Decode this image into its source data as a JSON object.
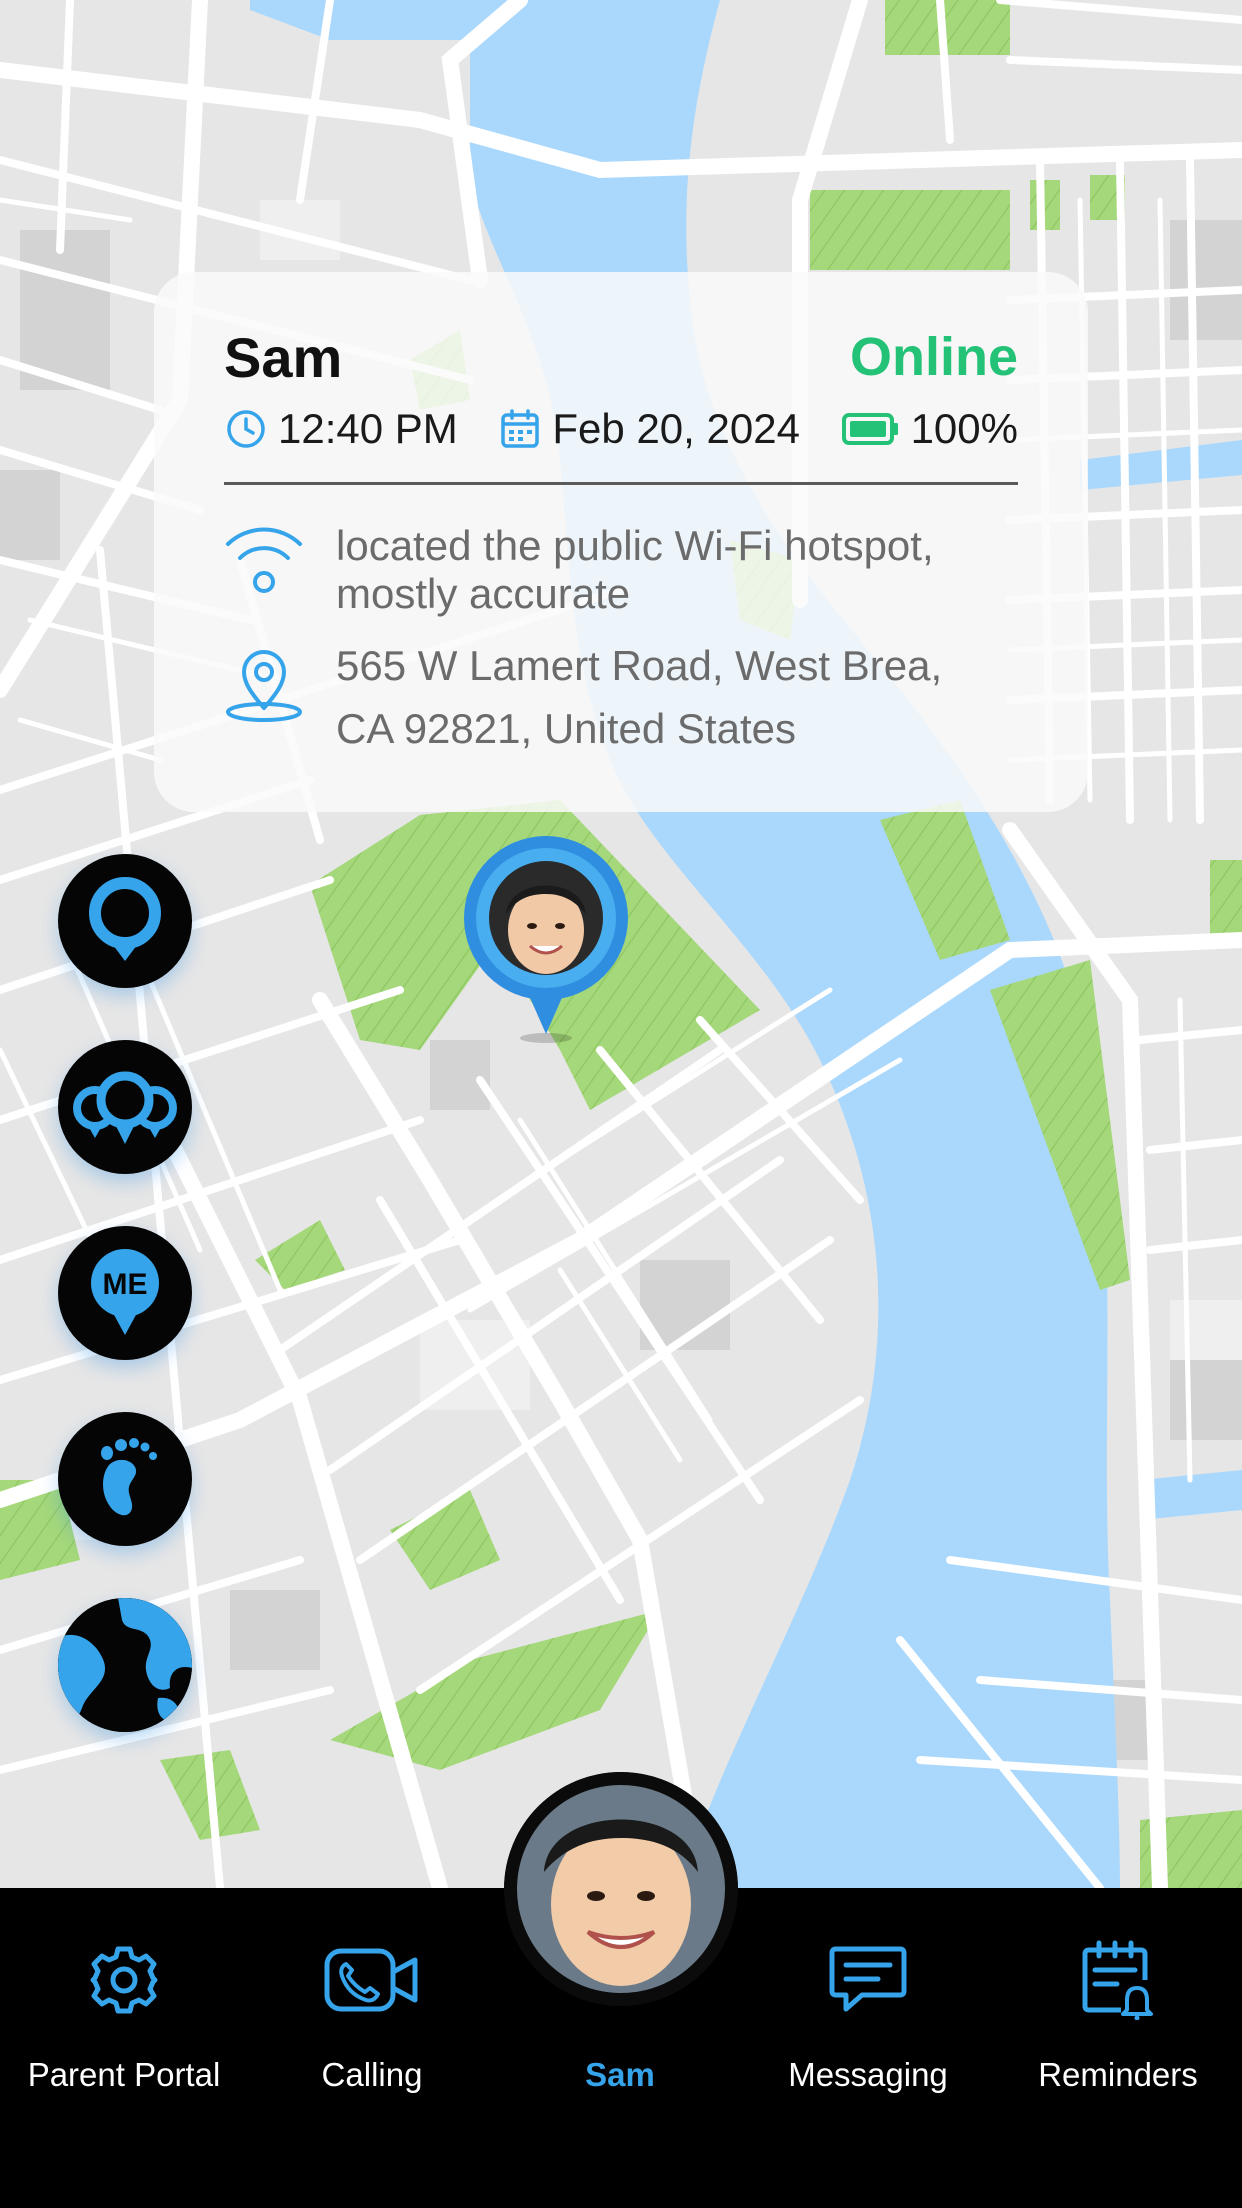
{
  "colors": {
    "accent_blue": "#35a4ea",
    "online_green": "#23c277",
    "water": "#aad8fd",
    "park": "#a5d87a",
    "land": "#e6e6e6",
    "road": "#ffffff"
  },
  "card": {
    "name": "Sam",
    "status": "Online",
    "time": "12:40 PM",
    "date": "Feb 20, 2024",
    "battery": "100%",
    "battery_level": 1.0,
    "wifi_text": "located the public Wi-Fi hotspot, mostly accurate",
    "address_line1": "565 W Lamert Road, West Brea,",
    "address_line2": "CA 92821, United States"
  },
  "side_buttons": [
    {
      "name": "location-pin-button",
      "icon": "single-pin-icon"
    },
    {
      "name": "group-location-button",
      "icon": "multi-pin-icon"
    },
    {
      "name": "me-location-button",
      "icon": "me-pin-icon"
    },
    {
      "name": "footprint-button",
      "icon": "footprints-icon"
    },
    {
      "name": "globe-button",
      "icon": "globe-icon"
    }
  ],
  "nav": {
    "parent_portal": "Parent Portal",
    "calling": "Calling",
    "sam": "Sam",
    "messaging": "Messaging",
    "reminders": "Reminders"
  }
}
